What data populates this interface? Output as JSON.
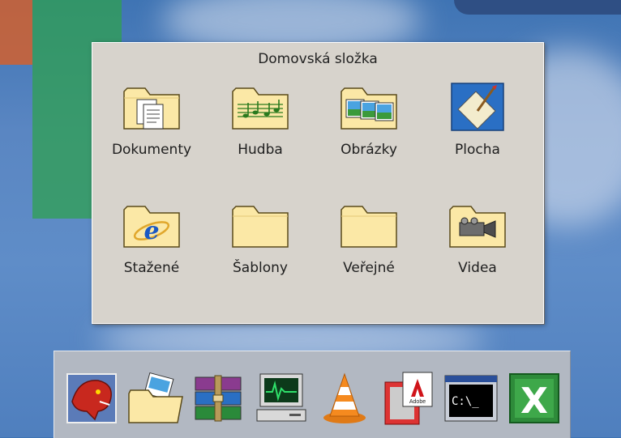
{
  "window": {
    "title": "Domovská složka"
  },
  "folders": [
    {
      "label": "Dokumenty",
      "icon": "documents-folder-icon"
    },
    {
      "label": "Hudba",
      "icon": "music-folder-icon"
    },
    {
      "label": "Obrázky",
      "icon": "pictures-folder-icon"
    },
    {
      "label": "Plocha",
      "icon": "desktop-icon"
    },
    {
      "label": "Stažené",
      "icon": "downloads-ie-folder-icon"
    },
    {
      "label": "Šablony",
      "icon": "folder-icon"
    },
    {
      "label": "Veřejné",
      "icon": "folder-icon"
    },
    {
      "label": "Videa",
      "icon": "video-camera-folder-icon"
    }
  ],
  "dock": {
    "items": [
      {
        "icon": "red-dragon-app-icon"
      },
      {
        "icon": "file-manager-folder-icon"
      },
      {
        "icon": "winrar-archive-icon"
      },
      {
        "icon": "system-monitor-icon"
      },
      {
        "icon": "vlc-cone-icon"
      },
      {
        "icon": "adobe-reader-icon"
      },
      {
        "icon": "terminal-icon",
        "text": "C:\\_"
      },
      {
        "icon": "excel-icon",
        "text": "X"
      }
    ]
  },
  "colors": {
    "folder_fill": "#fbe8a6",
    "folder_stroke": "#5a4a1a",
    "panel_bg": "#d7d3cc",
    "dock_bg": "#b2b8c2"
  }
}
